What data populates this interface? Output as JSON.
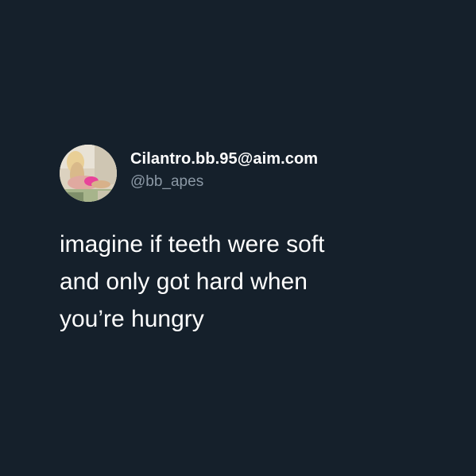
{
  "tweet": {
    "display_name": "Cilantro.bb.95@aim.com",
    "handle": "@bb_apes",
    "avatar_icon": "profile-photo",
    "text_lines": [
      "imagine if teeth were soft",
      "and only got hard when",
      "you’re hungry"
    ]
  },
  "colors": {
    "background": "#15202b",
    "primary_text": "#ffffff",
    "secondary_text": "#8b98a5"
  }
}
